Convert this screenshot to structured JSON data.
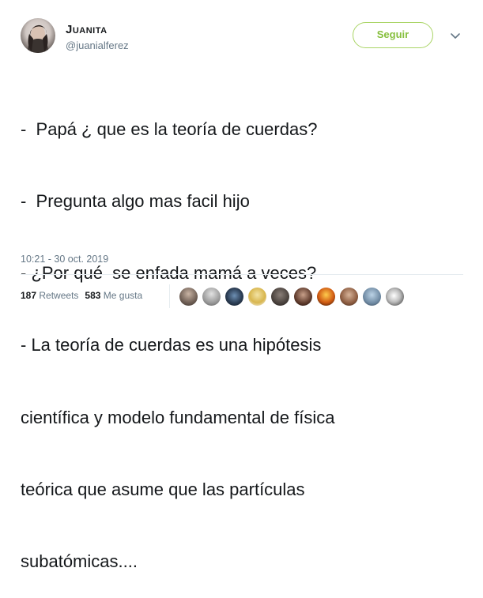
{
  "author": {
    "display_name": "Juanita",
    "handle": "@juanialferez"
  },
  "header": {
    "follow_label": "Seguir",
    "caret_icon": "chevron-down-icon"
  },
  "tweet": {
    "lines": [
      "-  Papá ¿ que es la teoría de cuerdas?",
      "-  Pregunta algo mas facil hijo",
      "- ¿Por qué  se enfada mamá a veces?",
      "- La teoría de cuerdas es una hipótesis",
      "científica y modelo fundamental de física",
      "teórica que asume que las partículas",
      "subatómicas...."
    ],
    "timestamp": "10:21 - 30 oct. 2019"
  },
  "stats": {
    "retweets_count": "187",
    "retweets_label": "Retweets",
    "likes_count": "583",
    "likes_label": "Me gusta"
  },
  "colors": {
    "follow_accent": "#86bf3d",
    "follow_border": "#a9d465",
    "secondary_text": "#657786",
    "divider": "#e6ecf0"
  }
}
